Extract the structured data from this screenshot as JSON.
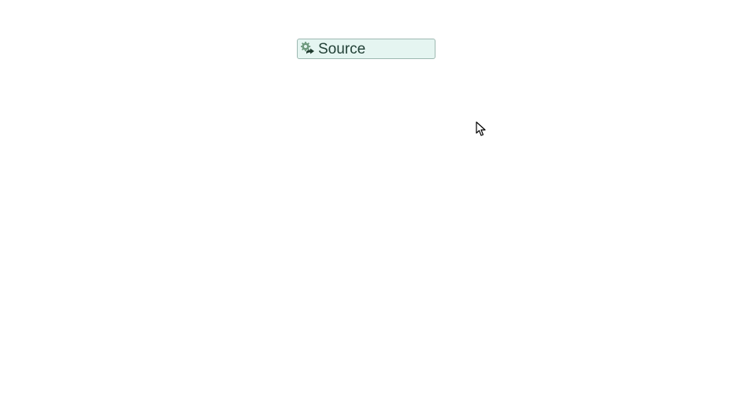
{
  "node": {
    "label": "Source",
    "icon_name": "source-forward-icon"
  }
}
